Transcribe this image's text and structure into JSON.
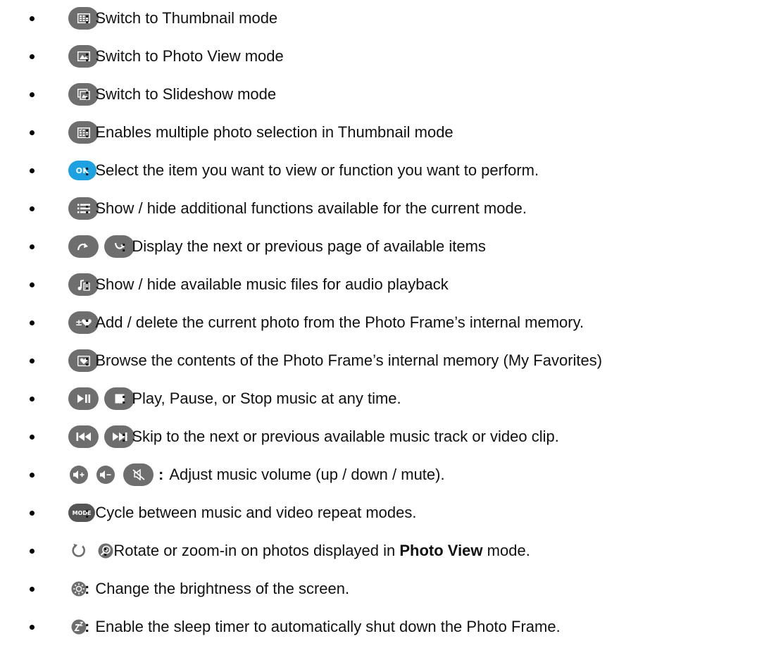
{
  "items": [
    {
      "icons": [
        "thumbnail-mode-icon"
      ],
      "colon": ":",
      "text": "Switch to Thumbnail mode"
    },
    {
      "icons": [
        "photo-view-icon"
      ],
      "colon": ":",
      "text": "Switch to Photo View mode"
    },
    {
      "icons": [
        "slideshow-icon"
      ],
      "colon": ":",
      "text": "Switch to Slideshow mode"
    },
    {
      "icons": [
        "multi-select-icon"
      ],
      "colon": ":",
      "text": "Enables multiple photo selection in Thumbnail mode"
    },
    {
      "icons": [
        "ok-icon"
      ],
      "colon": ":",
      "text": "Select the item you want to view or function you want to perform.",
      "ok_label": "OK"
    },
    {
      "icons": [
        "menu-icon"
      ],
      "colon": ":",
      "text": "Show / hide additional functions available for the current mode."
    },
    {
      "icons": [
        "page-up-icon",
        "page-down-icon"
      ],
      "colon": ":",
      "text": "Display the next or previous page of available items"
    },
    {
      "icons": [
        "music-files-icon"
      ],
      "colon": ":",
      "text": "Show / hide available music files for audio playback"
    },
    {
      "icons": [
        "add-delete-favorite-icon"
      ],
      "colon": ":",
      "text": "Add / delete the current photo from the Photo Frame’s internal memory."
    },
    {
      "icons": [
        "favorites-icon"
      ],
      "colon": ":",
      "text": "Browse the contents of the Photo Frame’s internal memory (My Favorites)"
    },
    {
      "icons": [
        "play-pause-icon",
        "stop-icon"
      ],
      "colon": ":",
      "text": "Play, Pause, or Stop music at any time."
    },
    {
      "icons": [
        "previous-track-icon",
        "next-track-icon"
      ],
      "colon": ":",
      "text": "Skip to the next or previous available music track or video clip."
    },
    {
      "icons": [
        "volume-up-icon",
        "volume-down-icon",
        "mute-icon"
      ],
      "colon": ":",
      "text": "Adjust music volume (up / down / mute)."
    },
    {
      "icons": [
        "mode-icon"
      ],
      "colon": ":",
      "text": "Cycle between music and video repeat modes.",
      "mode_label": "MODE"
    },
    {
      "icons": [
        "rotate-icon",
        "zoom-in-icon"
      ],
      "colon": ":",
      "text_before": "Rotate or zoom-in on photos displayed in",
      "text_bold": "Photo View",
      "text_after": "mode."
    },
    {
      "icons": [
        "brightness-icon"
      ],
      "colon": ":",
      "text": "Change the brightness of the screen."
    },
    {
      "icons": [
        "sleep-timer-icon"
      ],
      "colon": ":",
      "text": "Enable the sleep timer to automatically shut down the Photo Frame."
    }
  ],
  "colors": {
    "button_gray": "#6e6e6e",
    "ok_blue": "#1da1e0",
    "text": "#111111"
  }
}
